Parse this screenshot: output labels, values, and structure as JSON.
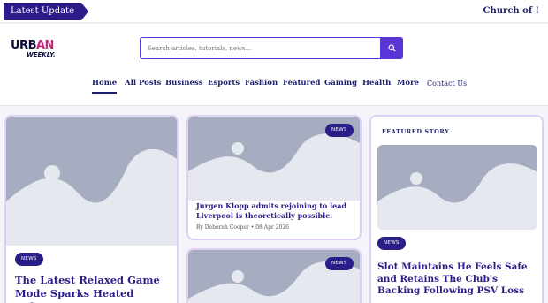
{
  "topbar": {
    "latest_label": "Latest Update",
    "ticker_text": "Church of !"
  },
  "logo": {
    "line1_a": "URB",
    "line1_b": "AN",
    "line2": "WEEKLY."
  },
  "search": {
    "placeholder": "Search articles, tutorials, news..."
  },
  "nav": {
    "items": [
      {
        "label": "Home"
      },
      {
        "label": "All Posts"
      },
      {
        "label": "Business"
      },
      {
        "label": "Esports"
      },
      {
        "label": "Fashion"
      },
      {
        "label": "Featured"
      },
      {
        "label": "Gaming"
      },
      {
        "label": "Health"
      },
      {
        "label": "More"
      },
      {
        "label": "Contact Us"
      }
    ]
  },
  "cards": {
    "left": {
      "badge": "NEWS",
      "title": "The Latest Relaxed Game Mode Sparks Heated Debates Over AI"
    },
    "mid1": {
      "badge": "NEWS",
      "title": "Jurgen Klopp admits rejoining to lead Liverpool is theoretically possible.",
      "author": "By Deborah Cooper",
      "date": "08 Apr 2026"
    },
    "mid2": {
      "badge": "NEWS"
    },
    "featured": {
      "label": "FEATURED STORY",
      "badge": "NEWS",
      "title": "Slot Maintains He Feels Safe and Retains The Club's Backing Following PSV Loss"
    }
  },
  "colors": {
    "accent": "#5a36d6",
    "navy": "#1b1f6b",
    "badge": "#2a1e88",
    "card_border": "#ddd0f4"
  }
}
